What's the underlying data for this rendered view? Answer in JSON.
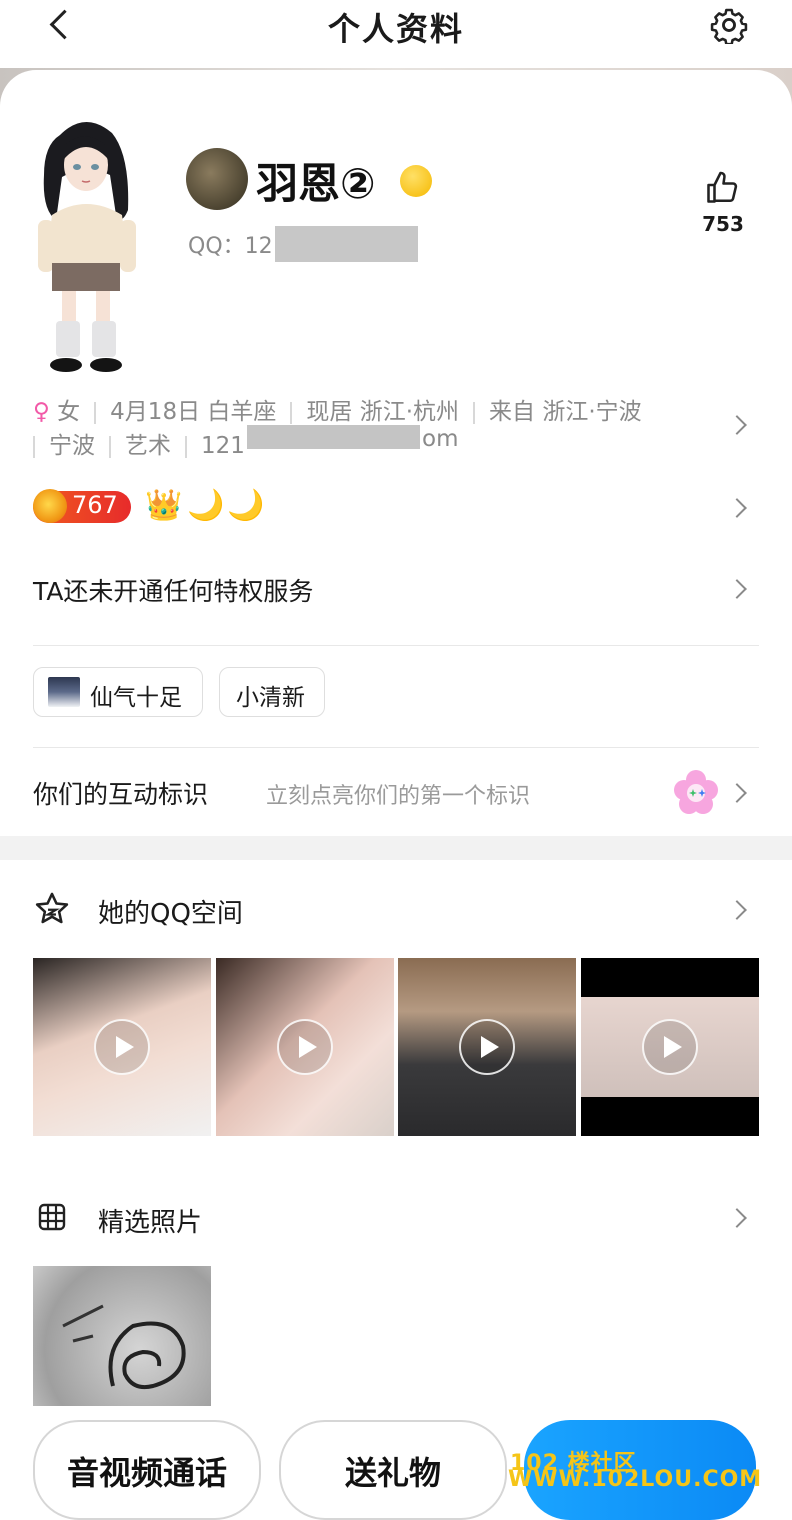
{
  "nav": {
    "title": "个人资料"
  },
  "profile": {
    "nickname": "羽恩②",
    "qq_label": "QQ：12",
    "likes": "753"
  },
  "info": {
    "gender_symbol": "♀",
    "gender": "女",
    "birthday": "4月18日 白羊座",
    "location": "现居 浙江·杭州",
    "hometown": "来自 浙江·宁波",
    "hometown_city": "宁波",
    "occupation": "艺术",
    "email_prefix": "121",
    "email_suffix": "om"
  },
  "level": {
    "value": "767",
    "icons": [
      "👑",
      "🌙",
      "🌙"
    ]
  },
  "privilege": {
    "label": "TA还未开通任何特权服务"
  },
  "tags": [
    "仙气十足",
    "小清新"
  ],
  "interaction": {
    "label": "你们的互动标识",
    "hint": "立刻点亮你们的第一个标识"
  },
  "qzone": {
    "label": "她的QQ空间"
  },
  "photos": {
    "label": "精选照片"
  },
  "bottom_bar": {
    "call_label": "音视频通话",
    "gift_label": "送礼物"
  },
  "watermark": {
    "line1": "102 楼社区",
    "line2": "WWW.102LOU.COM"
  },
  "colors": {
    "accent": "#1296f7",
    "female": "#f25aa8",
    "level_badge": "#e93a24"
  }
}
